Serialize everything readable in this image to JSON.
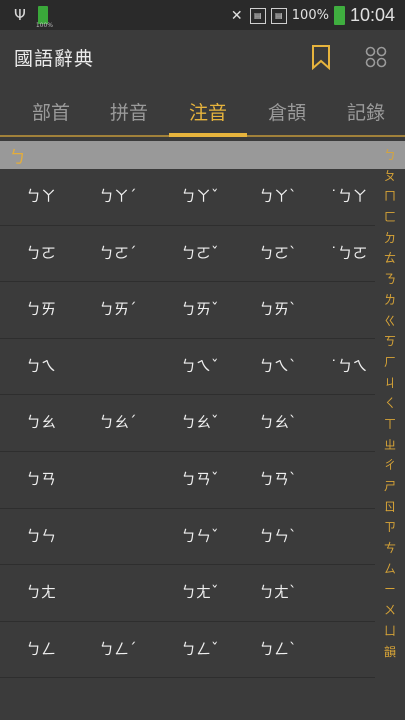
{
  "status": {
    "battery_small": "100%",
    "battery_pct": "100%",
    "time": "10:04"
  },
  "app": {
    "title": "國語辭典"
  },
  "tabs": [
    {
      "label": "部首"
    },
    {
      "label": "拼音"
    },
    {
      "label": "注音"
    },
    {
      "label": "倉頡"
    },
    {
      "label": "記錄"
    }
  ],
  "header": {
    "label": "ㄅ"
  },
  "rows": [
    [
      "ㄅㄚ",
      "ㄅㄚˊ",
      "ㄅㄚˇ",
      "ㄅㄚˋ",
      "˙ㄅㄚ"
    ],
    [
      "ㄅㄛ",
      "ㄅㄛˊ",
      "ㄅㄛˇ",
      "ㄅㄛˋ",
      "˙ㄅㄛ"
    ],
    [
      "ㄅㄞ",
      "ㄅㄞˊ",
      "ㄅㄞˇ",
      "ㄅㄞˋ",
      ""
    ],
    [
      "ㄅㄟ",
      "",
      "ㄅㄟˇ",
      "ㄅㄟˋ",
      "˙ㄅㄟ"
    ],
    [
      "ㄅㄠ",
      "ㄅㄠˊ",
      "ㄅㄠˇ",
      "ㄅㄠˋ",
      ""
    ],
    [
      "ㄅㄢ",
      "",
      "ㄅㄢˇ",
      "ㄅㄢˋ",
      ""
    ],
    [
      "ㄅㄣ",
      "",
      "ㄅㄣˇ",
      "ㄅㄣˋ",
      ""
    ],
    [
      "ㄅㄤ",
      "",
      "ㄅㄤˇ",
      "ㄅㄤˋ",
      ""
    ],
    [
      "ㄅㄥ",
      "ㄅㄥˊ",
      "ㄅㄥˇ",
      "ㄅㄥˋ",
      ""
    ]
  ],
  "index": [
    "ㄅ",
    "ㄆ",
    "ㄇ",
    "ㄈ",
    "ㄉ",
    "ㄊ",
    "ㄋ",
    "ㄌ",
    "ㄍ",
    "ㄎ",
    "ㄏ",
    "ㄐ",
    "ㄑ",
    "ㄒ",
    "ㄓ",
    "ㄔ",
    "ㄕ",
    "ㄖ",
    "ㄗ",
    "ㄘ",
    "ㄙ",
    "ㄧ",
    "ㄨ",
    "ㄩ",
    "韻"
  ]
}
